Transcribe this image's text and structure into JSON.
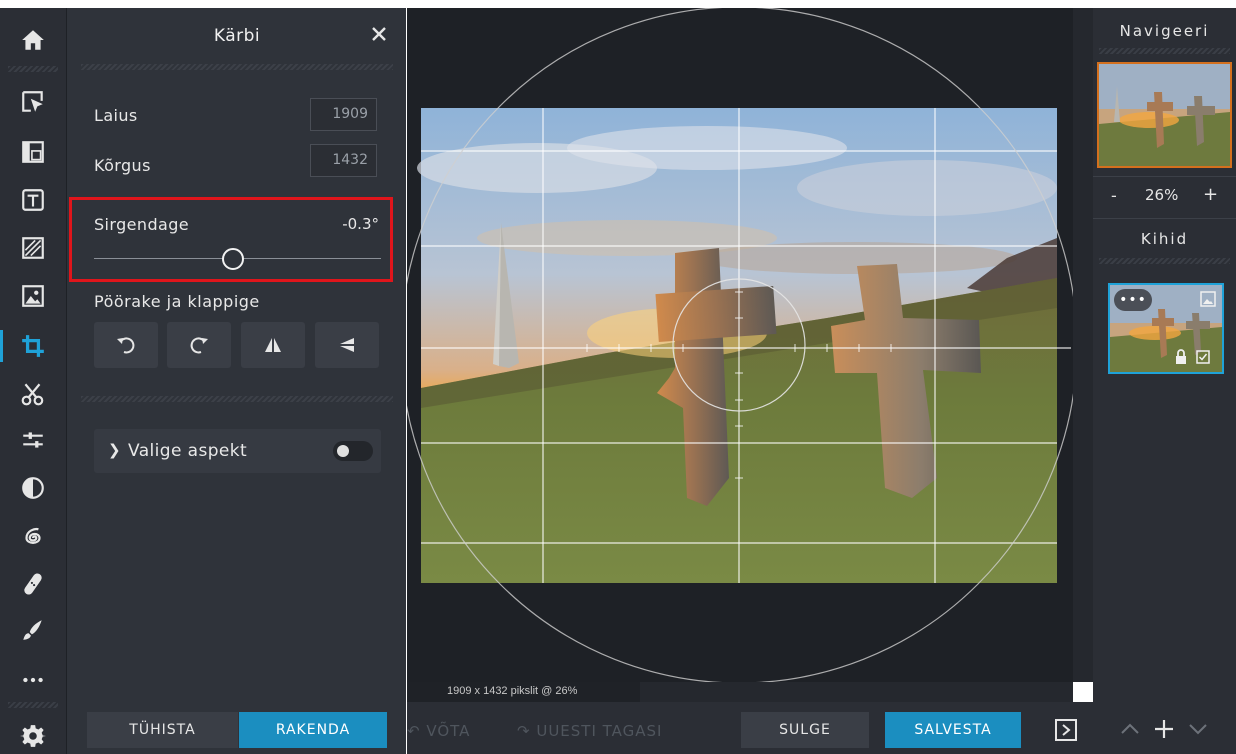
{
  "panel": {
    "title": "Kärbi",
    "width_label": "Laius",
    "width_value": "1909",
    "height_label": "Kõrgus",
    "height_value": "1432",
    "straighten_label": "Sirgendage",
    "straighten_value": "-0.3°",
    "rotate_flip_label": "Pöörake ja klappige",
    "aspect_label": "Valige aspekt",
    "cancel_label": "TÜHISTA",
    "apply_label": "RAKENDA"
  },
  "status": {
    "text": "1909 x 1432 pikslit @ 26%"
  },
  "bottom": {
    "undo_label": "VÕTA",
    "redo_label": "UUESTI TAGASI",
    "close_label": "SULGE",
    "save_label": "SALVESTA"
  },
  "navigator": {
    "title": "Navigeeri",
    "zoom_minus": "-",
    "zoom_value": "26%",
    "zoom_plus": "+"
  },
  "layers": {
    "title": "Kihid",
    "menu_label": "•••"
  },
  "colors": {
    "accent": "#1b8ec0",
    "highlight_border": "#e0151b",
    "navigator_border": "#d4701e"
  },
  "icons": [
    "home-icon",
    "select-icon",
    "layout-icon",
    "text-icon",
    "pattern-icon",
    "image-icon",
    "crop-icon",
    "cut-icon",
    "adjust-icon",
    "contrast-icon",
    "swirl-icon",
    "bandage-icon",
    "brush-icon",
    "more-icon",
    "settings-icon"
  ]
}
